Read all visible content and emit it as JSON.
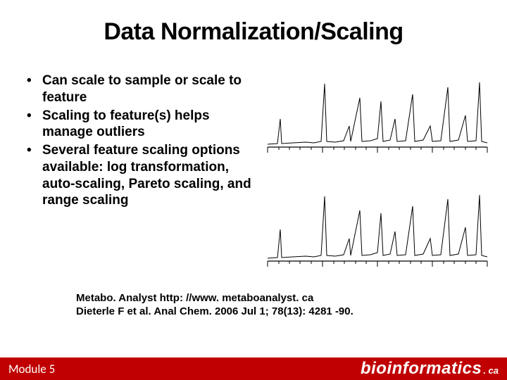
{
  "title": "Data Normalization/Scaling",
  "bullets": [
    "Can scale to sample or scale to feature",
    "Scaling to feature(s) helps manage outliers",
    "Several feature scaling options available: log transformation, auto-scaling, Pareto scaling, and range scaling"
  ],
  "citation": {
    "line1": "Metabo. Analyst http: //www. metaboanalyst. ca",
    "line2": "Dieterle F et al. Anal Chem. 2006 Jul 1; 78(13): 4281 -90."
  },
  "footer": {
    "module": "Module 5",
    "brand_main": "bioinformatics",
    "brand_suffix": ". ca"
  }
}
